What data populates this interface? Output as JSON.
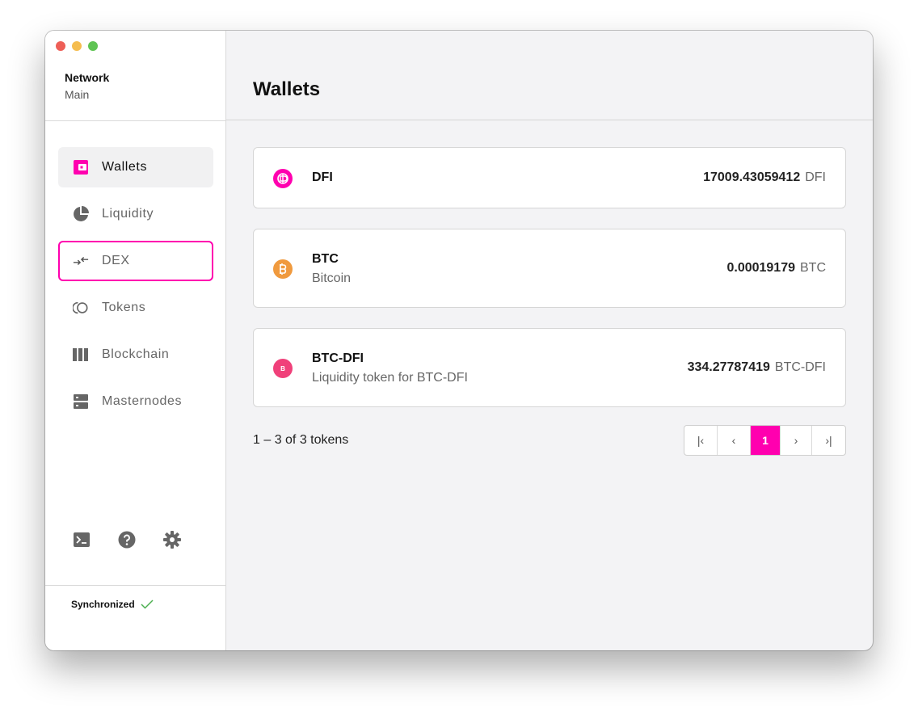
{
  "sidebar": {
    "network_label": "Network",
    "network_value": "Main",
    "items": [
      {
        "label": "Wallets",
        "icon": "wallet-icon"
      },
      {
        "label": "Liquidity",
        "icon": "pie-chart-icon"
      },
      {
        "label": "DEX",
        "icon": "swap-arrows-icon"
      },
      {
        "label": "Tokens",
        "icon": "tokens-icon"
      },
      {
        "label": "Blockchain",
        "icon": "blockchain-icon"
      },
      {
        "label": "Masternodes",
        "icon": "server-icon"
      }
    ],
    "status": "Synchronized"
  },
  "main": {
    "title": "Wallets",
    "tokens": [
      {
        "symbol": "DFI",
        "name": "",
        "amount": "17009.43059412",
        "unit": "DFI",
        "color": "#ff00af"
      },
      {
        "symbol": "BTC",
        "name": "Bitcoin",
        "amount": "0.00019179",
        "unit": "BTC",
        "color": "#f7931a"
      },
      {
        "symbol": "BTC-DFI",
        "name": "Liquidity token for BTC-DFI",
        "amount": "334.27787419",
        "unit": "BTC-DFI",
        "color": "#f0407a",
        "badge": "B"
      }
    ],
    "pagination": {
      "summary": "1 – 3 of 3 tokens",
      "first": "|‹",
      "prev": "‹",
      "current": "1",
      "next": "›",
      "last": "›|"
    }
  },
  "colors": {
    "accent": "#ff00af",
    "success": "#4caf50"
  }
}
